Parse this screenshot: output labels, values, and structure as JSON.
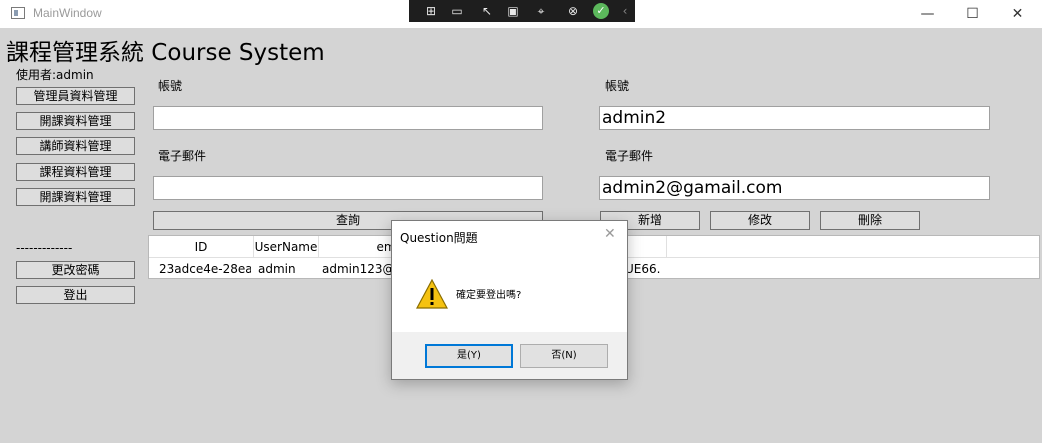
{
  "window": {
    "title": "MainWindow"
  },
  "app": {
    "title": "課程管理系統 Course System",
    "user_label": "使用者:admin"
  },
  "sidebar": {
    "buttons": [
      "管理員資料管理",
      "開課資料管理",
      "講師資料管理",
      "課程資料管理",
      "開課資料管理"
    ],
    "separator": "-------------",
    "change_password": "更改密碼",
    "logout": "登出"
  },
  "search_form": {
    "account_label": "帳號",
    "account_value": "",
    "email_label": "電子郵件",
    "email_value": "",
    "query_button": "查詢"
  },
  "edit_form": {
    "account_label": "帳號",
    "account_value": "admin2",
    "email_label": "電子郵件",
    "email_value": "admin2@gamail.com",
    "add_button": "新增",
    "modify_button": "修改",
    "delete_button": "刪除"
  },
  "grid": {
    "columns": [
      "ID",
      "UserName",
      "em"
    ],
    "rows": [
      {
        "id": "23adce4e-28ea",
        "username": "admin",
        "email": "admin123@",
        "extra": "UE66."
      }
    ]
  },
  "dialog": {
    "title": "Question問題",
    "message": "確定要登出嗎?",
    "yes_button": "是(Y)",
    "no_button": "否(N)",
    "icon": "warning-icon"
  },
  "colors": {
    "background": "#d4d4d4",
    "titlebar": "#ffffff",
    "dialog_footer": "#f0f0f0",
    "warning": "#f5c211"
  }
}
